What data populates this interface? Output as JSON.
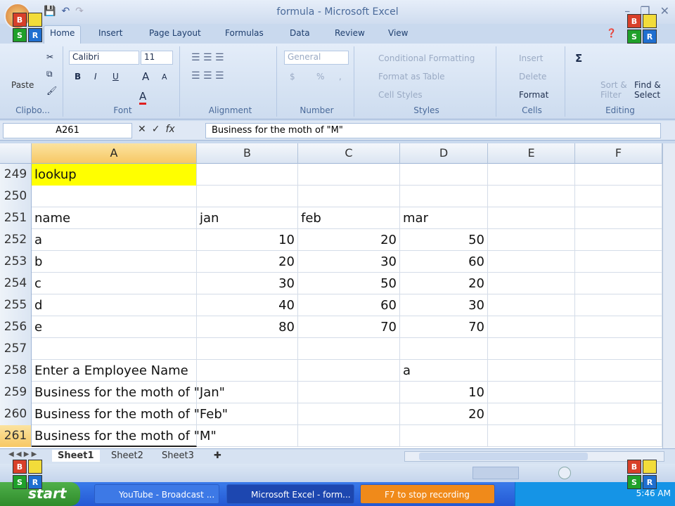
{
  "window": {
    "title": "formula - Microsoft Excel"
  },
  "ribbon_tabs": [
    "Home",
    "Insert",
    "Page Layout",
    "Formulas",
    "Data",
    "Review",
    "View"
  ],
  "ribbon": {
    "clipboard": {
      "paste": "Paste",
      "label": "Clipbo..."
    },
    "font": {
      "name": "Calibri",
      "size": "11",
      "bold": "B",
      "italic": "I",
      "underline": "U",
      "grow": "A",
      "shrink": "A",
      "color": "A",
      "label": "Font"
    },
    "alignment": {
      "label": "Alignment"
    },
    "number": {
      "format": "General",
      "currency": "$",
      "percent": "%",
      "comma": ",",
      "label": "Number"
    },
    "styles": {
      "conditional": "Conditional Formatting",
      "table": "Format as Table",
      "cell": "Cell Styles",
      "label": "Styles"
    },
    "cells": {
      "insert": "Insert",
      "delete": "Delete",
      "format": "Format",
      "label": "Cells"
    },
    "editing": {
      "sum": "Σ",
      "sort": "Sort & Filter",
      "find": "Find & Select",
      "label": "Editing"
    }
  },
  "formula_bar": {
    "name_box": "A261",
    "fx": "fx",
    "value": "Business for the moth of \"M\""
  },
  "columns": [
    "A",
    "B",
    "C",
    "D",
    "E",
    "F"
  ],
  "rows": [
    {
      "n": "249",
      "cells": [
        "lookup",
        "",
        "",
        "",
        "",
        ""
      ]
    },
    {
      "n": "250",
      "cells": [
        "",
        "",
        "",
        "",
        "",
        ""
      ]
    },
    {
      "n": "251",
      "cells": [
        "name",
        "jan",
        "feb",
        "mar",
        "",
        ""
      ]
    },
    {
      "n": "252",
      "cells": [
        "a",
        "10",
        "20",
        "50",
        "",
        ""
      ]
    },
    {
      "n": "253",
      "cells": [
        "b",
        "20",
        "30",
        "60",
        "",
        ""
      ]
    },
    {
      "n": "254",
      "cells": [
        "c",
        "30",
        "50",
        "20",
        "",
        ""
      ]
    },
    {
      "n": "255",
      "cells": [
        "d",
        "40",
        "60",
        "30",
        "",
        ""
      ]
    },
    {
      "n": "256",
      "cells": [
        "e",
        "80",
        "70",
        "70",
        "",
        ""
      ]
    },
    {
      "n": "257",
      "cells": [
        "",
        "",
        "",
        "",
        "",
        ""
      ]
    },
    {
      "n": "258",
      "cells": [
        "Enter a Employee Name",
        "",
        "",
        "a",
        "",
        ""
      ]
    },
    {
      "n": "259",
      "cells": [
        "Business for the moth of \"Jan\"",
        "",
        "",
        "10",
        "",
        ""
      ]
    },
    {
      "n": "260",
      "cells": [
        "Business for the moth of \"Feb\"",
        "",
        "",
        "20",
        "",
        ""
      ]
    },
    {
      "n": "261",
      "cells": [
        "Business for the moth of \"M\"",
        "",
        "",
        "",
        "",
        ""
      ]
    }
  ],
  "highlight_color": "#ffff00",
  "sheets": [
    "Sheet1",
    "Sheet2",
    "Sheet3"
  ],
  "active_sheet": "Sheet1",
  "taskbar": {
    "start": "start",
    "tasks": [
      "YouTube - Broadcast ...",
      "Microsoft Excel - form...",
      "F7 to stop recording"
    ],
    "clock": "5:46 AM"
  },
  "logo_letters": [
    "B",
    "",
    "S",
    "R"
  ]
}
